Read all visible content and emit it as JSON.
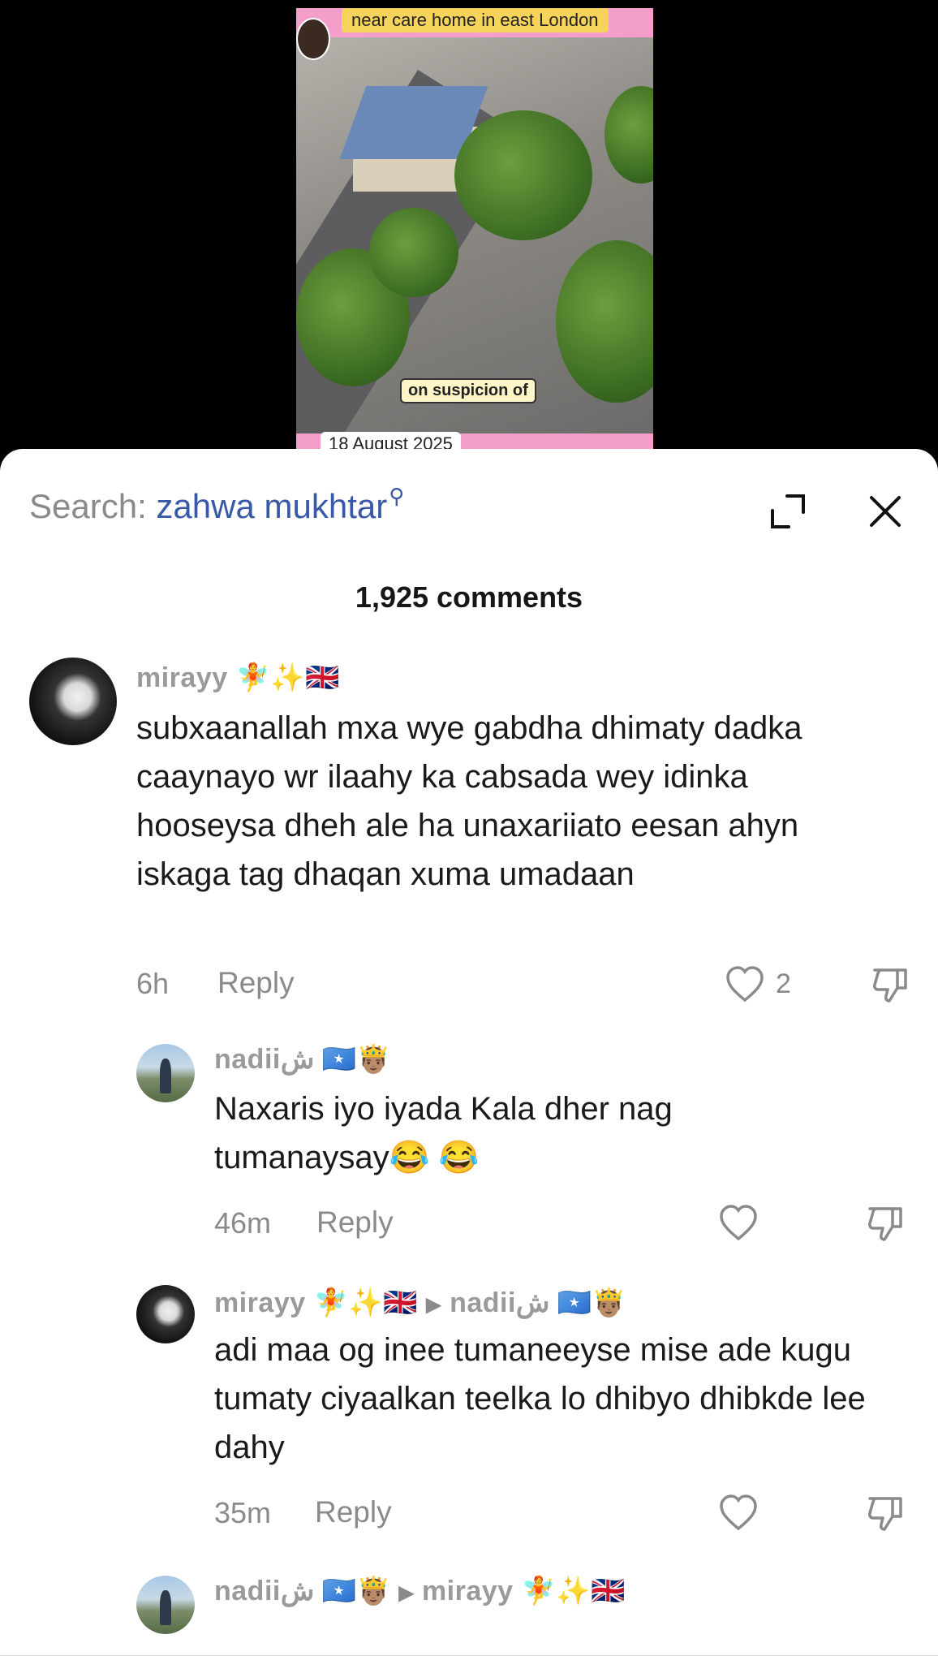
{
  "video": {
    "top_caption": "near care home in east London",
    "subtitle": "on suspicion of",
    "date": "18 August 2025"
  },
  "sheet": {
    "search_prefix": "Search: ",
    "search_term": "zahwa mukhtar",
    "comment_count": "1,925 comments"
  },
  "comments": [
    {
      "username": "mirayy",
      "user_emojis": "🧚✨🇬🇧",
      "text": "subxaanallah mxa wye gabdha dhimaty dadka caaynayo wr ilaahy ka cabsada wey idinka hooseysa dheh ale ha unaxariiato eesan ahyn iskaga tag dhaqan xuma umadaan",
      "time": "6h",
      "reply_label": "Reply",
      "likes": "2"
    },
    {
      "username": "nadiiش",
      "user_emojis": "🇸🇴🤴🏽",
      "text": "Naxaris iyo iyada Kala dher nag tumanaysay😂 😂",
      "time": "46m",
      "reply_label": "Reply"
    },
    {
      "username": "mirayy",
      "user_emojis": "🧚✨🇬🇧",
      "reply_to": "nadiiش",
      "reply_to_emojis": "🇸🇴🤴🏽",
      "text": "adi maa og inee tumaneeyse mise ade kugu tumaty ciyaalkan teelka lo dhibyo dhibkde lee dahy",
      "time": "35m",
      "reply_label": "Reply"
    },
    {
      "username": "nadiiش",
      "user_emojis": "🇸🇴🤴🏽",
      "reply_to": "mirayy",
      "reply_to_emojis": "🧚✨🇬🇧"
    }
  ],
  "colors": {
    "accent": "#3858a8",
    "muted": "#8a8a8a",
    "text": "#1a1a1a"
  }
}
